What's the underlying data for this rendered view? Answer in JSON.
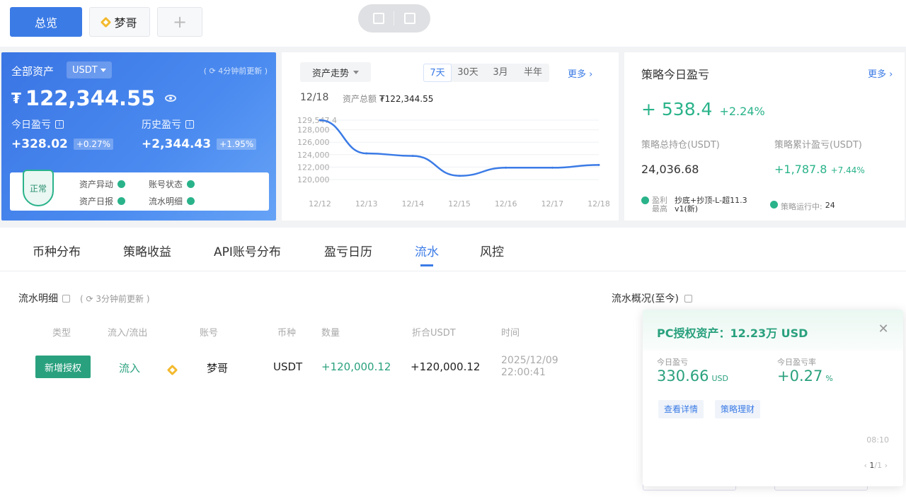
{
  "top_tabs": {
    "overview": "总览",
    "account": "梦哥",
    "add": "+"
  },
  "asset": {
    "title": "全部资产",
    "currency": "USDT",
    "updated": "( ⟳ 4分钟前更新 )",
    "currency_symbol": "₮",
    "total": "122,344.55",
    "today_label": "今日盈亏",
    "today_value": "+328.02",
    "today_pct": "+0.27%",
    "history_label": "历史盈亏",
    "history_value": "+2,344.43",
    "history_pct": "+1.95%",
    "status": "正常",
    "items": [
      "资产异动",
      "账号状态",
      "资产日报",
      "流水明细"
    ]
  },
  "trend": {
    "selector": "资产走势",
    "ranges": [
      "7天",
      "30天",
      "3月",
      "半年"
    ],
    "active_range": "7天",
    "more": "更多 ›",
    "date": "12/18",
    "total_label": "资产总额",
    "total_value": "₮122,344.55"
  },
  "chart_data": {
    "type": "line",
    "x": [
      "12/12",
      "12/13",
      "12/14",
      "12/15",
      "12/16",
      "12/17",
      "12/18"
    ],
    "series": [
      {
        "values": [
          129547.4,
          124200,
          123800,
          120600,
          121900,
          121900,
          122344.55
        ]
      }
    ],
    "y_ticks": [
      "129,547.4",
      "128,000",
      "126,000",
      "124,000",
      "122,000",
      "120,000"
    ],
    "ylim": [
      120000,
      129547.4
    ],
    "grid": true,
    "color": "#3b7be6"
  },
  "strategy": {
    "title": "策略今日盈亏",
    "more": "更多 ›",
    "pnl": "+ 538.4",
    "pnl_pct": "+2.24%",
    "position_label": "策略总持仓(USDT)",
    "position_value": "24,036.68",
    "cum_label": "策略累计盈亏(USDT)",
    "cum_value": "+1,787.8",
    "cum_pct": "+7.44%",
    "best_label": "盈利最高",
    "best_value": "抄底+抄顶-L-超11.3 v1(新)",
    "running_label": "策略运行中:",
    "running_value": "24"
  },
  "main_tabs": [
    "币种分布",
    "策略收益",
    "API账号分布",
    "盈亏日历",
    "流水",
    "风控"
  ],
  "flow": {
    "title": "流水明细",
    "updated": "( ⟳ 3分钟前更新 )",
    "overview": "流水概况(至今)",
    "headers": [
      "类型",
      "流入/流出",
      "账号",
      "币种",
      "数量",
      "折合USDT",
      "时间"
    ],
    "row": {
      "type": "新增授权",
      "direction": "流入",
      "account": "梦哥",
      "coin": "USDT",
      "amount": "+120,000.12",
      "usdt": "+120,000.12",
      "time_date": "2025/12/09",
      "time_clock": "22:00:41"
    }
  },
  "popup": {
    "title": "PC授权资产：12.23万 USD",
    "today_label": "今日盈亏",
    "today_value": "330.66",
    "today_unit": "USD",
    "rate_label": "今日盈亏率",
    "rate_value": "+0.27",
    "rate_unit": "%",
    "btn_detail": "查看详情",
    "btn_finance": "策略理财",
    "time": "08:10",
    "pager_prev": "‹",
    "pager_current": "1",
    "pager_total": "/1 ›"
  }
}
